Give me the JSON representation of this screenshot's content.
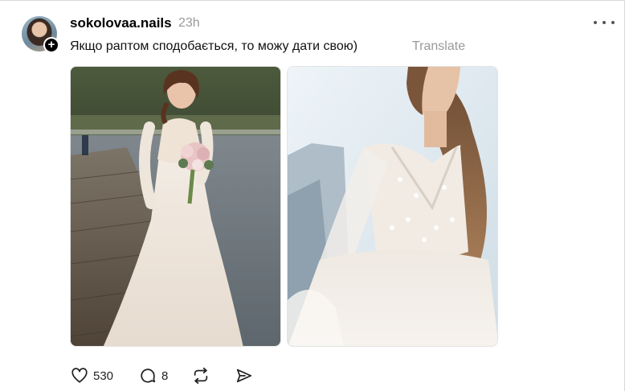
{
  "post": {
    "username": "sokolovaa.nails",
    "time": "23h",
    "text": "Якщо раптом сподобається, то можу дати свою)",
    "translate_label": "Translate",
    "avatar_plus": "+"
  },
  "images": [
    {
      "alt": "bride-on-pier-photo"
    },
    {
      "alt": "wedding-dress-closeup-photo"
    }
  ],
  "actions": {
    "likes": "530",
    "comments": "8"
  },
  "icons": {
    "like": "heart-icon",
    "comment": "comment-bubble-icon",
    "repost": "repost-icon",
    "share": "send-icon",
    "more": "more-dots-icon"
  }
}
